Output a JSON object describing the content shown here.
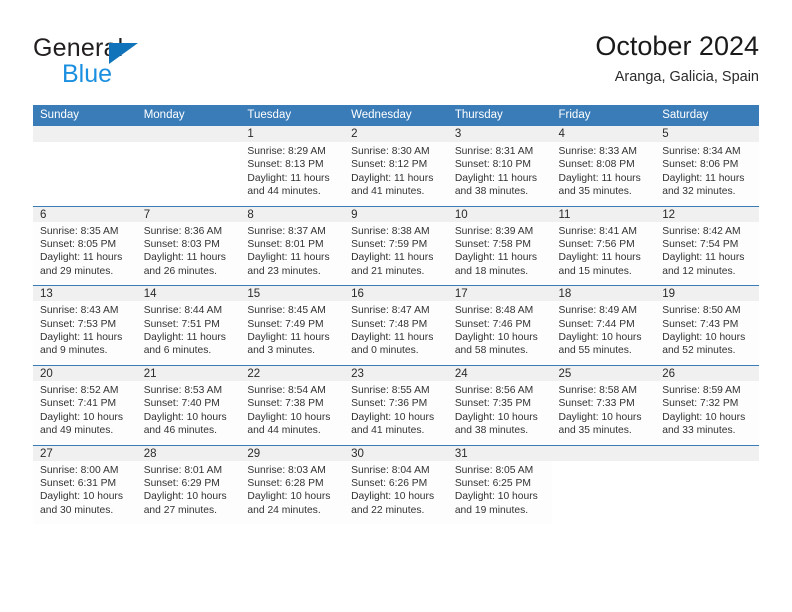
{
  "brand": {
    "name_part1": "General",
    "name_part2": "Blue",
    "triangle_color": "#1173ba",
    "blue_color": "#1b8fe0"
  },
  "header": {
    "title": "October 2024",
    "subtitle": "Aranga, Galicia, Spain"
  },
  "theme": {
    "header_bg": "#3a7cb8",
    "daynum_bg": "#f0f0f0",
    "text": "#333333"
  },
  "calendar": {
    "weekdays": [
      "Sunday",
      "Monday",
      "Tuesday",
      "Wednesday",
      "Thursday",
      "Friday",
      "Saturday"
    ],
    "weeks": [
      [
        {
          "day": "",
          "sunrise": "",
          "sunset": "",
          "daylight_line1": "",
          "daylight_line2": "",
          "empty": true
        },
        {
          "day": "",
          "sunrise": "",
          "sunset": "",
          "daylight_line1": "",
          "daylight_line2": "",
          "empty": true
        },
        {
          "day": "1",
          "sunrise": "Sunrise: 8:29 AM",
          "sunset": "Sunset: 8:13 PM",
          "daylight_line1": "Daylight: 11 hours",
          "daylight_line2": "and 44 minutes."
        },
        {
          "day": "2",
          "sunrise": "Sunrise: 8:30 AM",
          "sunset": "Sunset: 8:12 PM",
          "daylight_line1": "Daylight: 11 hours",
          "daylight_line2": "and 41 minutes."
        },
        {
          "day": "3",
          "sunrise": "Sunrise: 8:31 AM",
          "sunset": "Sunset: 8:10 PM",
          "daylight_line1": "Daylight: 11 hours",
          "daylight_line2": "and 38 minutes."
        },
        {
          "day": "4",
          "sunrise": "Sunrise: 8:33 AM",
          "sunset": "Sunset: 8:08 PM",
          "daylight_line1": "Daylight: 11 hours",
          "daylight_line2": "and 35 minutes."
        },
        {
          "day": "5",
          "sunrise": "Sunrise: 8:34 AM",
          "sunset": "Sunset: 8:06 PM",
          "daylight_line1": "Daylight: 11 hours",
          "daylight_line2": "and 32 minutes."
        }
      ],
      [
        {
          "day": "6",
          "sunrise": "Sunrise: 8:35 AM",
          "sunset": "Sunset: 8:05 PM",
          "daylight_line1": "Daylight: 11 hours",
          "daylight_line2": "and 29 minutes."
        },
        {
          "day": "7",
          "sunrise": "Sunrise: 8:36 AM",
          "sunset": "Sunset: 8:03 PM",
          "daylight_line1": "Daylight: 11 hours",
          "daylight_line2": "and 26 minutes."
        },
        {
          "day": "8",
          "sunrise": "Sunrise: 8:37 AM",
          "sunset": "Sunset: 8:01 PM",
          "daylight_line1": "Daylight: 11 hours",
          "daylight_line2": "and 23 minutes."
        },
        {
          "day": "9",
          "sunrise": "Sunrise: 8:38 AM",
          "sunset": "Sunset: 7:59 PM",
          "daylight_line1": "Daylight: 11 hours",
          "daylight_line2": "and 21 minutes."
        },
        {
          "day": "10",
          "sunrise": "Sunrise: 8:39 AM",
          "sunset": "Sunset: 7:58 PM",
          "daylight_line1": "Daylight: 11 hours",
          "daylight_line2": "and 18 minutes."
        },
        {
          "day": "11",
          "sunrise": "Sunrise: 8:41 AM",
          "sunset": "Sunset: 7:56 PM",
          "daylight_line1": "Daylight: 11 hours",
          "daylight_line2": "and 15 minutes."
        },
        {
          "day": "12",
          "sunrise": "Sunrise: 8:42 AM",
          "sunset": "Sunset: 7:54 PM",
          "daylight_line1": "Daylight: 11 hours",
          "daylight_line2": "and 12 minutes."
        }
      ],
      [
        {
          "day": "13",
          "sunrise": "Sunrise: 8:43 AM",
          "sunset": "Sunset: 7:53 PM",
          "daylight_line1": "Daylight: 11 hours",
          "daylight_line2": "and 9 minutes."
        },
        {
          "day": "14",
          "sunrise": "Sunrise: 8:44 AM",
          "sunset": "Sunset: 7:51 PM",
          "daylight_line1": "Daylight: 11 hours",
          "daylight_line2": "and 6 minutes."
        },
        {
          "day": "15",
          "sunrise": "Sunrise: 8:45 AM",
          "sunset": "Sunset: 7:49 PM",
          "daylight_line1": "Daylight: 11 hours",
          "daylight_line2": "and 3 minutes."
        },
        {
          "day": "16",
          "sunrise": "Sunrise: 8:47 AM",
          "sunset": "Sunset: 7:48 PM",
          "daylight_line1": "Daylight: 11 hours",
          "daylight_line2": "and 0 minutes."
        },
        {
          "day": "17",
          "sunrise": "Sunrise: 8:48 AM",
          "sunset": "Sunset: 7:46 PM",
          "daylight_line1": "Daylight: 10 hours",
          "daylight_line2": "and 58 minutes."
        },
        {
          "day": "18",
          "sunrise": "Sunrise: 8:49 AM",
          "sunset": "Sunset: 7:44 PM",
          "daylight_line1": "Daylight: 10 hours",
          "daylight_line2": "and 55 minutes."
        },
        {
          "day": "19",
          "sunrise": "Sunrise: 8:50 AM",
          "sunset": "Sunset: 7:43 PM",
          "daylight_line1": "Daylight: 10 hours",
          "daylight_line2": "and 52 minutes."
        }
      ],
      [
        {
          "day": "20",
          "sunrise": "Sunrise: 8:52 AM",
          "sunset": "Sunset: 7:41 PM",
          "daylight_line1": "Daylight: 10 hours",
          "daylight_line2": "and 49 minutes."
        },
        {
          "day": "21",
          "sunrise": "Sunrise: 8:53 AM",
          "sunset": "Sunset: 7:40 PM",
          "daylight_line1": "Daylight: 10 hours",
          "daylight_line2": "and 46 minutes."
        },
        {
          "day": "22",
          "sunrise": "Sunrise: 8:54 AM",
          "sunset": "Sunset: 7:38 PM",
          "daylight_line1": "Daylight: 10 hours",
          "daylight_line2": "and 44 minutes."
        },
        {
          "day": "23",
          "sunrise": "Sunrise: 8:55 AM",
          "sunset": "Sunset: 7:36 PM",
          "daylight_line1": "Daylight: 10 hours",
          "daylight_line2": "and 41 minutes."
        },
        {
          "day": "24",
          "sunrise": "Sunrise: 8:56 AM",
          "sunset": "Sunset: 7:35 PM",
          "daylight_line1": "Daylight: 10 hours",
          "daylight_line2": "and 38 minutes."
        },
        {
          "day": "25",
          "sunrise": "Sunrise: 8:58 AM",
          "sunset": "Sunset: 7:33 PM",
          "daylight_line1": "Daylight: 10 hours",
          "daylight_line2": "and 35 minutes."
        },
        {
          "day": "26",
          "sunrise": "Sunrise: 8:59 AM",
          "sunset": "Sunset: 7:32 PM",
          "daylight_line1": "Daylight: 10 hours",
          "daylight_line2": "and 33 minutes."
        }
      ],
      [
        {
          "day": "27",
          "sunrise": "Sunrise: 8:00 AM",
          "sunset": "Sunset: 6:31 PM",
          "daylight_line1": "Daylight: 10 hours",
          "daylight_line2": "and 30 minutes."
        },
        {
          "day": "28",
          "sunrise": "Sunrise: 8:01 AM",
          "sunset": "Sunset: 6:29 PM",
          "daylight_line1": "Daylight: 10 hours",
          "daylight_line2": "and 27 minutes."
        },
        {
          "day": "29",
          "sunrise": "Sunrise: 8:03 AM",
          "sunset": "Sunset: 6:28 PM",
          "daylight_line1": "Daylight: 10 hours",
          "daylight_line2": "and 24 minutes."
        },
        {
          "day": "30",
          "sunrise": "Sunrise: 8:04 AM",
          "sunset": "Sunset: 6:26 PM",
          "daylight_line1": "Daylight: 10 hours",
          "daylight_line2": "and 22 minutes."
        },
        {
          "day": "31",
          "sunrise": "Sunrise: 8:05 AM",
          "sunset": "Sunset: 6:25 PM",
          "daylight_line1": "Daylight: 10 hours",
          "daylight_line2": "and 19 minutes."
        },
        {
          "day": "",
          "sunrise": "",
          "sunset": "",
          "daylight_line1": "",
          "daylight_line2": "",
          "empty": true
        },
        {
          "day": "",
          "sunrise": "",
          "sunset": "",
          "daylight_line1": "",
          "daylight_line2": "",
          "empty": true
        }
      ]
    ]
  }
}
